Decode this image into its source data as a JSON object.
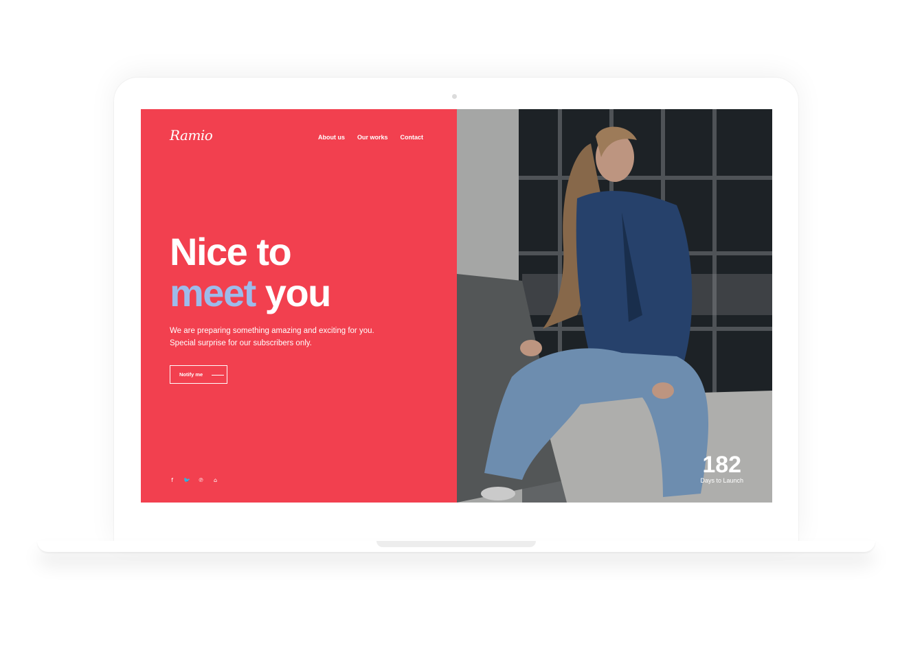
{
  "brand": {
    "logo": "Ramio"
  },
  "nav": {
    "items": [
      "About us",
      "Our works",
      "Contact"
    ]
  },
  "hero": {
    "line1": "Nice to",
    "line2_accent": "meet",
    "line2_rest": "you",
    "tagline": "We are preparing something amazing and exciting for you. Special surprise for our subscribers only.",
    "cta": "Notify me"
  },
  "socials": {
    "facebook": "f",
    "twitter": "🐦",
    "pinterest": "℗",
    "github": "⌂"
  },
  "countdown": {
    "value": "182",
    "label": "Days to Launch"
  },
  "colors": {
    "primary": "#f2404f",
    "accent": "#9dbbea"
  }
}
